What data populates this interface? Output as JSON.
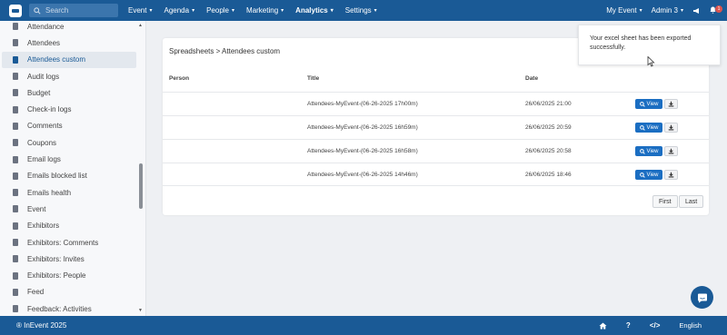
{
  "topbar": {
    "search_placeholder": "Search",
    "nav": [
      "Event",
      "Agenda",
      "People",
      "Marketing",
      "Analytics",
      "Settings"
    ],
    "active_nav": "Analytics",
    "event_menu": "My Event",
    "user_menu": "Admin 3",
    "notification_count": "1"
  },
  "sidebar": {
    "items": [
      "Attendance",
      "Attendees",
      "Attendees custom",
      "Audit logs",
      "Budget",
      "Check-in logs",
      "Comments",
      "Coupons",
      "Email logs",
      "Emails blocked list",
      "Emails health",
      "Event",
      "Exhibitors",
      "Exhibitors: Comments",
      "Exhibitors: Invites",
      "Exhibitors: People",
      "Feed",
      "Feedback: Activities"
    ],
    "active": "Attendees custom"
  },
  "main": {
    "breadcrumb": "Spreadsheets > Attendees custom",
    "columns": {
      "person": "Person",
      "title": "Title",
      "date": "Date"
    },
    "rows": [
      {
        "person": "",
        "title": "Attendees-MyEvent-(06-26-2025 17h00m)",
        "date": "26/06/2025 21:00"
      },
      {
        "person": "",
        "title": "Attendees-MyEvent-(06-26-2025 16h59m)",
        "date": "26/06/2025 20:59"
      },
      {
        "person": "",
        "title": "Attendees-MyEvent-(06-26-2025 16h58m)",
        "date": "26/06/2025 20:58"
      },
      {
        "person": "",
        "title": "Attendees-MyEvent-(06-26-2025 14h46m)",
        "date": "26/06/2025 18:46"
      }
    ],
    "view_label": "View",
    "pager": {
      "first": "First",
      "last": "Last"
    }
  },
  "toast": {
    "message": "Your excel sheet has been exported successfully."
  },
  "footer": {
    "copyright": "® InEvent 2025",
    "code_icon": "</>",
    "help_icon": "?",
    "language": "English"
  },
  "colors": {
    "brand": "#1a5a96",
    "button": "#1b6ec2",
    "badge": "#d9534f"
  }
}
